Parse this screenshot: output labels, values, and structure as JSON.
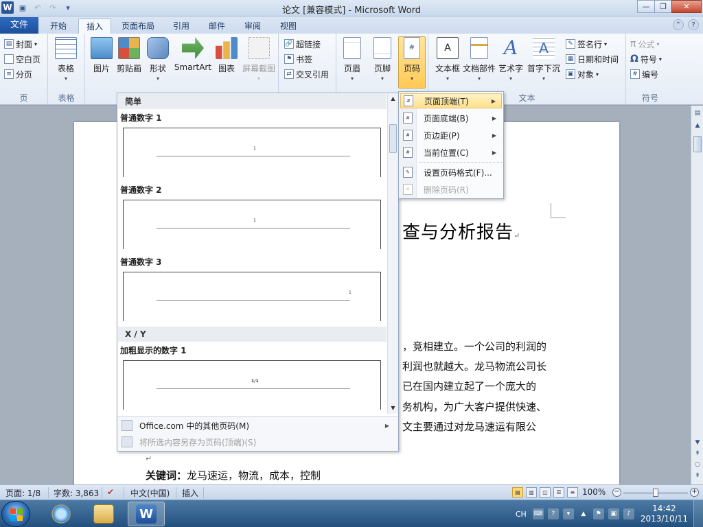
{
  "window": {
    "title": "论文 [兼容模式] - Microsoft Word",
    "app_icon": "W"
  },
  "tabs": [
    {
      "label": "文件"
    },
    {
      "label": "开始"
    },
    {
      "label": "插入"
    },
    {
      "label": "页面布局"
    },
    {
      "label": "引用"
    },
    {
      "label": "邮件"
    },
    {
      "label": "审阅"
    },
    {
      "label": "视图"
    }
  ],
  "ribbon": {
    "pages": {
      "cover": "封面",
      "blank": "空白页",
      "break": "分页",
      "group": "页"
    },
    "table": {
      "label": "表格",
      "group": "表格"
    },
    "illustrations": {
      "picture": "图片",
      "clipart": "剪贴画",
      "shapes": "形状",
      "smartart": "SmartArt",
      "chart": "图表",
      "screenshot": "屏幕截图"
    },
    "links": {
      "hyperlink": "超链接",
      "bookmark": "书签",
      "crossref": "交叉引用"
    },
    "header_footer": {
      "header": "页眉",
      "footer": "页脚",
      "pagenum": "页码"
    },
    "text": {
      "textbox": "文本框",
      "quickparts": "文档部件",
      "wordart": "艺术字",
      "dropcap": "首字下沉",
      "signature": "签名行",
      "datetime": "日期和时间",
      "object": "对象",
      "group": "文本"
    },
    "symbols": {
      "equation": "公式",
      "symbol": "符号",
      "number": "编号",
      "group": "符号"
    }
  },
  "gallery": {
    "section_simple": "简单",
    "items": [
      {
        "label": "普通数字 1"
      },
      {
        "label": "普通数字 2"
      },
      {
        "label": "普通数字 3"
      }
    ],
    "section_xy": "X / Y",
    "xy_item": "加粗显示的数字 1",
    "footer_more": "Office.com 中的其他页码(M)",
    "footer_save": "将所选内容另存为页码(顶端)(S)"
  },
  "page_number_menu": {
    "top": "页面顶端(T)",
    "bottom": "页面底端(B)",
    "margin": "页边距(P)",
    "current": "当前位置(C)",
    "format": "设置页码格式(F)...",
    "remove": "删除页码(R)"
  },
  "document": {
    "title": "查与分析报告",
    "lines": [
      "，竞相建立。一个公司的利润的",
      "利润也就越大。龙马物流公司长",
      "已在国内建立起了一个庞大的",
      "务机构，为广大客户提供快速、",
      "文主要通过对龙马速运有限公"
    ],
    "keywords_label": "关键词：",
    "keywords": "龙马速运，物流，成本，控制"
  },
  "statusbar": {
    "page": "页面: 1/8",
    "words": "字数: 3,863",
    "language": "中文(中国)",
    "mode": "插入",
    "zoom": "100%",
    "zoom_level": 1.0
  },
  "taskbar": {
    "ime": "CH",
    "time": "14:42",
    "date": "2013/10/11"
  }
}
